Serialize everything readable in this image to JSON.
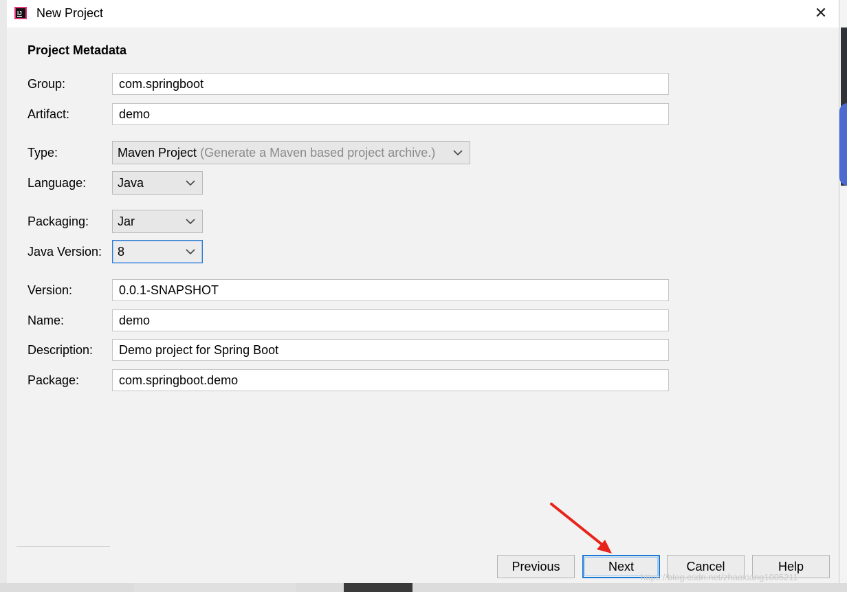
{
  "window": {
    "title": "New Project",
    "close_glyph": "✕"
  },
  "section_title": "Project Metadata",
  "fields": {
    "group": {
      "label": "Group:",
      "value": "com.springboot"
    },
    "artifact": {
      "label": "Artifact:",
      "value": "demo"
    },
    "type": {
      "label": "Type:",
      "value": "Maven Project",
      "hint": "(Generate a Maven based project archive.)"
    },
    "language": {
      "label": "Language:",
      "value": "Java"
    },
    "packaging": {
      "label": "Packaging:",
      "value": "Jar"
    },
    "java_version": {
      "label": "Java Version:",
      "value": "8"
    },
    "version": {
      "label": "Version:",
      "value": "0.0.1-SNAPSHOT"
    },
    "name": {
      "label": "Name:",
      "value": "demo"
    },
    "description": {
      "label": "Description:",
      "value": "Demo project for Spring Boot"
    },
    "package": {
      "label": "Package:",
      "value": "com.springboot.demo"
    }
  },
  "buttons": {
    "previous": "Previous",
    "next": "Next",
    "cancel": "Cancel",
    "help": "Help"
  },
  "annotation": {
    "arrow_color": "#e8231b"
  },
  "watermark": "https://blog.csdn.net/zhaoxiang1005211",
  "colors": {
    "focus": "#1a7ad8",
    "dialog_bg": "#f2f2f2"
  }
}
